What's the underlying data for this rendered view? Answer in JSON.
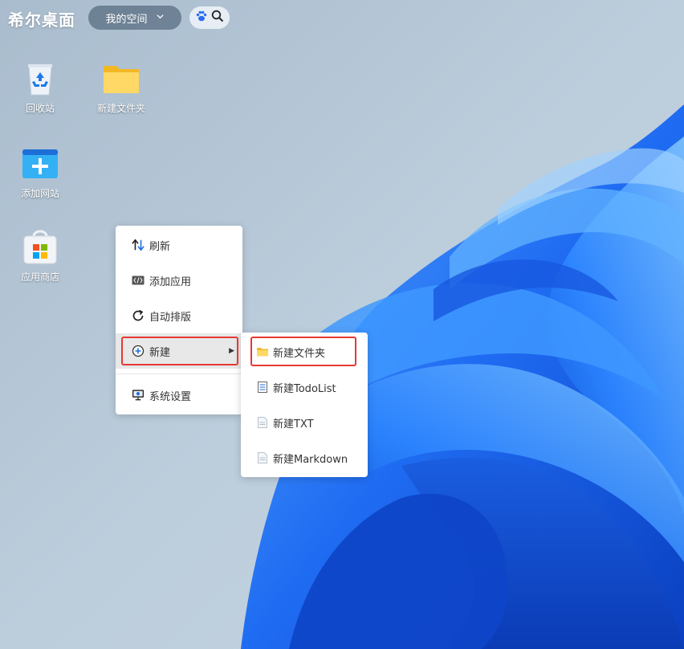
{
  "topbar": {
    "brand": "希尔桌面",
    "space_label": "我的空间",
    "space_icon": "chevron-down-icon",
    "search_icons": [
      "baidu-paw-icon",
      "search-icon"
    ]
  },
  "desktop_icons": [
    {
      "label": "回收站",
      "icon": "recycle-bin-icon"
    },
    {
      "label": "新建文件夹",
      "icon": "folder-icon"
    },
    {
      "label": "添加网站",
      "icon": "add-website-icon"
    },
    {
      "label": "应用商店",
      "icon": "app-store-icon"
    }
  ],
  "context_menu": {
    "items": [
      {
        "label": "刷新",
        "icon": "refresh-icon"
      },
      {
        "label": "添加应用",
        "icon": "code-app-icon"
      },
      {
        "label": "自动排版",
        "icon": "auto-arrange-icon"
      },
      {
        "label": "新建",
        "icon": "plus-circle-icon",
        "has_submenu": true,
        "active": true
      },
      {
        "label": "系统设置",
        "icon": "settings-monitor-icon"
      }
    ]
  },
  "submenu": {
    "items": [
      {
        "label": "新建文件夹",
        "icon": "folder-icon"
      },
      {
        "label": "新建TodoList",
        "icon": "todolist-icon"
      },
      {
        "label": "新建TXT",
        "icon": "txt-file-icon"
      },
      {
        "label": "新建Markdown",
        "icon": "markdown-file-icon"
      }
    ]
  },
  "colors": {
    "highlight_border": "#e53935",
    "wallpaper_bloom": "#2f7dfa",
    "wallpaper_background": "#b7c8d8"
  }
}
